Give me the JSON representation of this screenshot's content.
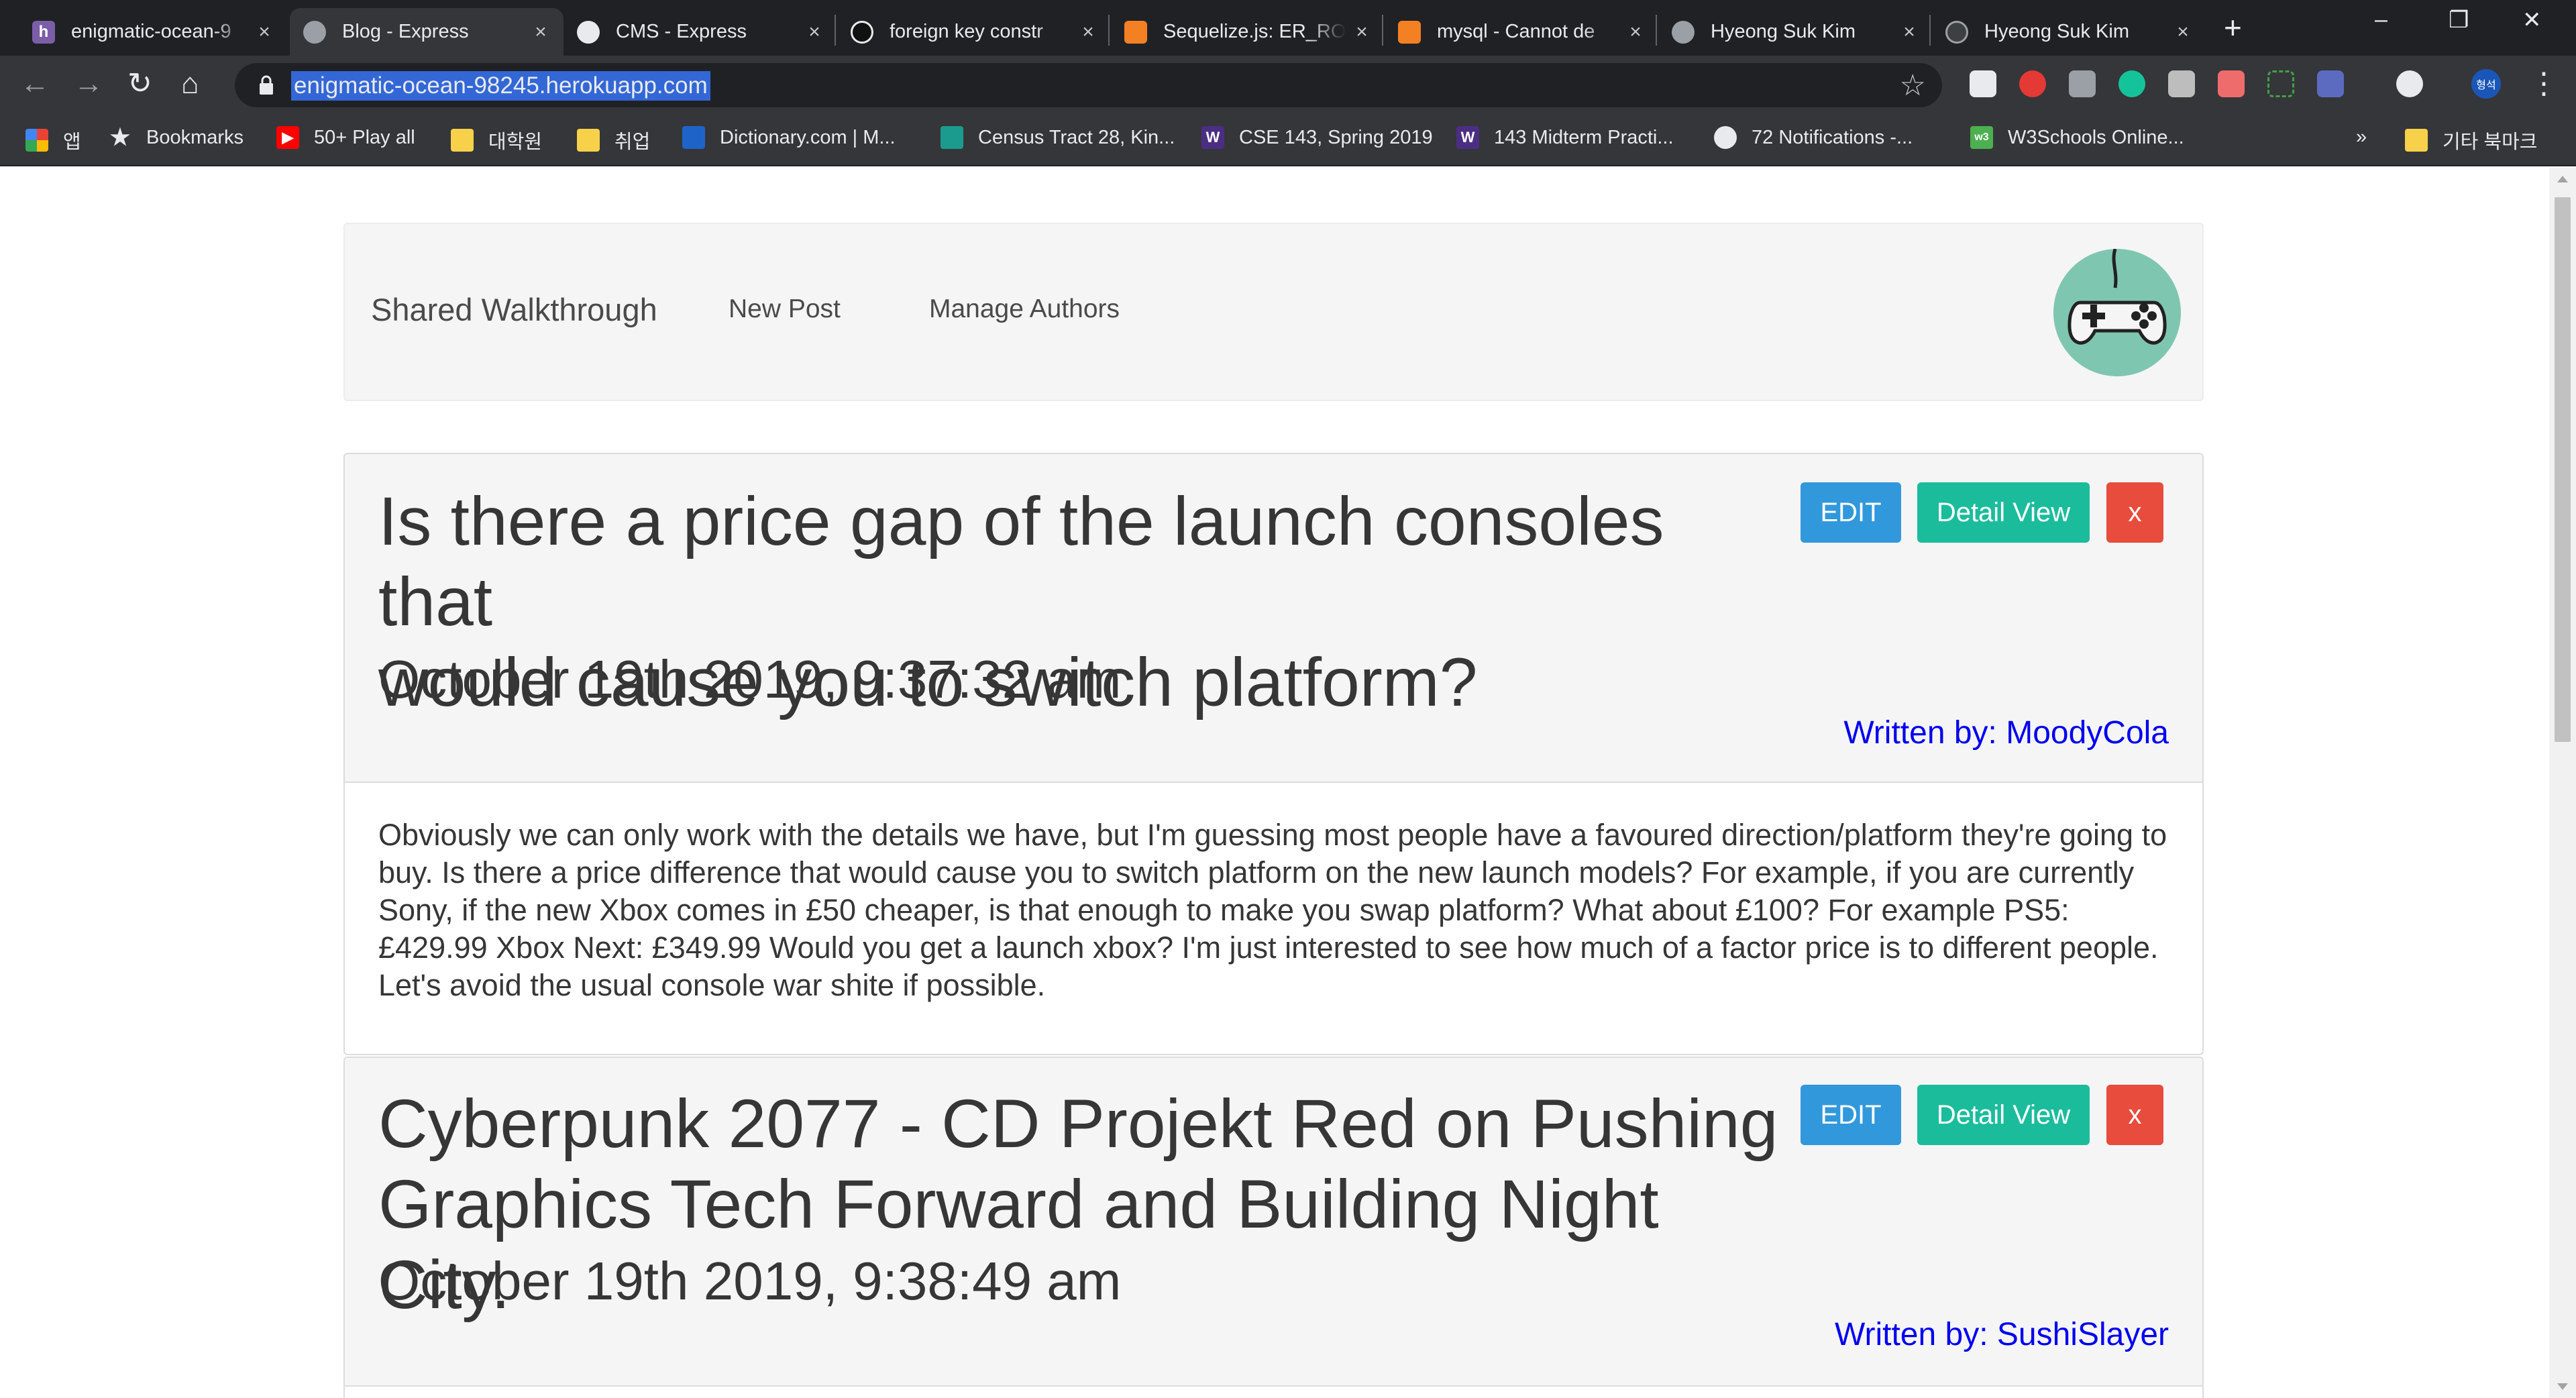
{
  "browser": {
    "tabs": [
      {
        "title": "enigmatic-ocean-9",
        "active": false
      },
      {
        "title": "Blog - Express",
        "active": true
      },
      {
        "title": "CMS - Express",
        "active": false
      },
      {
        "title": "foreign key constr",
        "active": false
      },
      {
        "title": "Sequelize.js: ER_RO",
        "active": false
      },
      {
        "title": "mysql - Cannot de",
        "active": false
      },
      {
        "title": "Hyeong Suk Kim",
        "active": false
      },
      {
        "title": "Hyeong Suk Kim",
        "active": false
      }
    ],
    "new_tab": "+",
    "url": "enigmatic-ocean-98245.herokuapp.com",
    "profile_initials": "형석",
    "bookmarks": [
      {
        "label": "앱",
        "icon": "apps-grid-icon"
      },
      {
        "label": "Bookmarks",
        "icon": "star-icon"
      },
      {
        "label": "50+ Play all",
        "icon": "youtube-icon"
      },
      {
        "label": "대학원",
        "icon": "folder-icon"
      },
      {
        "label": "취업",
        "icon": "folder-icon"
      },
      {
        "label": "Dictionary.com | M...",
        "icon": "dictionary-icon"
      },
      {
        "label": "Census Tract 28, Kin...",
        "icon": "census-icon"
      },
      {
        "label": "CSE 143, Spring 2019",
        "icon": "uw-icon"
      },
      {
        "label": "143 Midterm Practi...",
        "icon": "uw-icon"
      },
      {
        "label": "72 Notifications -...",
        "icon": "github-icon"
      },
      {
        "label": "W3Schools Online...",
        "icon": "w3schools-icon"
      }
    ],
    "bookmarks_overflow": "»",
    "other_bookmarks": "기타 북마크"
  },
  "site": {
    "brand": "Shared Walkthrough",
    "nav": [
      "New Post",
      "Manage Authors"
    ]
  },
  "posts": [
    {
      "title_line1": "Is there a price gap of the launch consoles that",
      "title_line2": "would cause you to switch platform?",
      "date": "October 19th 2019, 9:37:32 am",
      "author": "Written by: MoodyCola",
      "body": "Obviously we can only work with the details we have, but I'm guessing most people have a favoured direction/platform they're going to buy. Is there a price difference that would cause you to switch platform on the new launch models? For example, if you are currently Sony, if the new Xbox comes in £50 cheaper, is that enough to make you swap platform? What about £100? For example PS5: £429.99 Xbox Next: £349.99 Would you get a launch xbox? I'm just interested to see how much of a factor price is to different people. Let's avoid the usual console war shite if possible."
    },
    {
      "title_line1": "Cyberpunk 2077 - CD Projekt Red on Pushing",
      "title_line2": "Graphics Tech Forward and Building Night City.",
      "date": "October 19th 2019, 9:38:49 am",
      "author": "Written by: SushiSlayer"
    }
  ],
  "buttons": {
    "edit": "EDIT",
    "detail": "Detail View",
    "delete": "x"
  },
  "colors": {
    "edit": "#3298dc",
    "detail": "#1bbc9c",
    "delete": "#e74c3c",
    "author_link": "#0000ee",
    "logo_bg": "#7fc6b0"
  }
}
